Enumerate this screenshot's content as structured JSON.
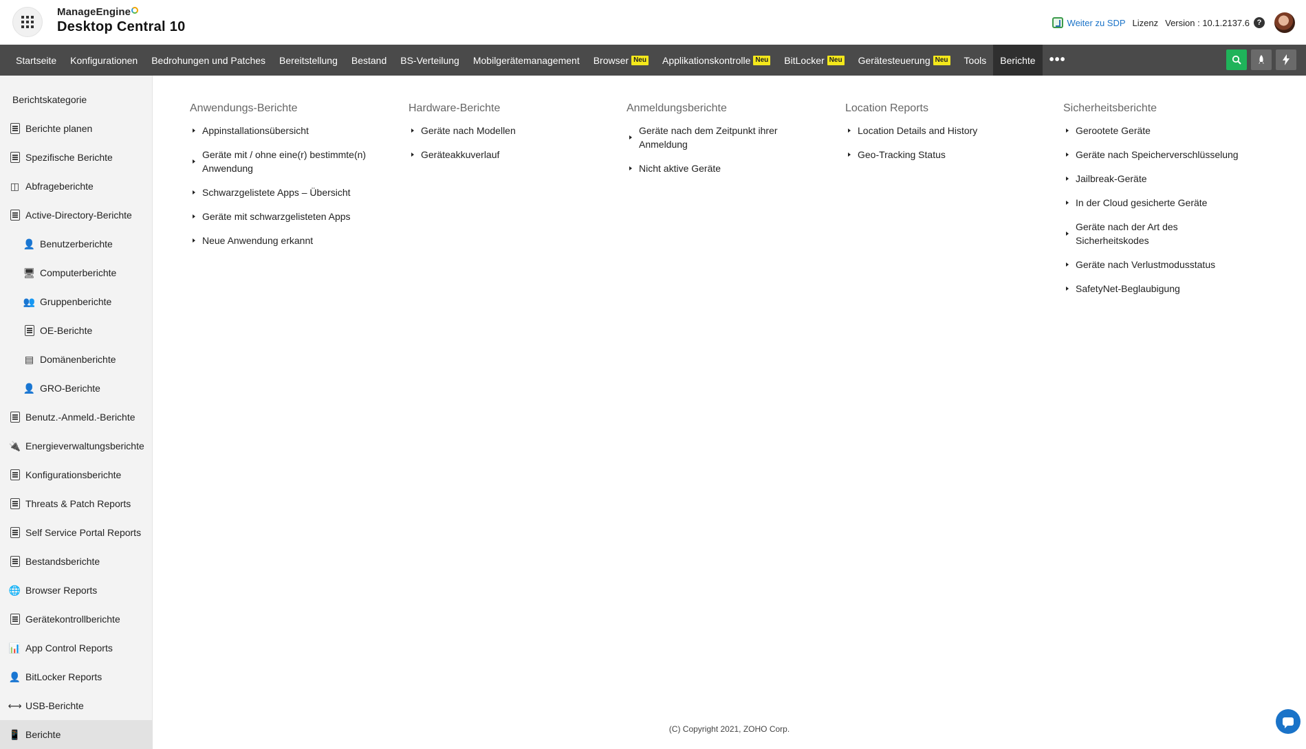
{
  "header": {
    "vendor": "ManageEngine",
    "product": "Desktop Central 10",
    "sdp_link": "Weiter zu SDP",
    "license": "Lizenz",
    "version": "Version : 10.1.2137.6",
    "help": "?"
  },
  "nav": {
    "items": [
      {
        "label": "Startseite",
        "badge": ""
      },
      {
        "label": "Konfigurationen",
        "badge": ""
      },
      {
        "label": "Bedrohungen und Patches",
        "badge": ""
      },
      {
        "label": "Bereitstellung",
        "badge": ""
      },
      {
        "label": "Bestand",
        "badge": ""
      },
      {
        "label": "BS-Verteilung",
        "badge": ""
      },
      {
        "label": "Mobilgerätemanagement",
        "badge": ""
      },
      {
        "label": "Browser",
        "badge": "Neu"
      },
      {
        "label": "Applikationskontrolle",
        "badge": "Neu"
      },
      {
        "label": "BitLocker",
        "badge": "Neu"
      },
      {
        "label": "Gerätesteuerung",
        "badge": "Neu"
      },
      {
        "label": "Tools",
        "badge": ""
      },
      {
        "label": "Berichte",
        "badge": ""
      }
    ],
    "more": "•••",
    "tool_icons": [
      "search-icon",
      "rocket-icon",
      "lightning-icon"
    ]
  },
  "sidebar": {
    "heading": "Berichtskategorie",
    "items": [
      {
        "label": "Berichte planen",
        "icon": "schedule-report-icon"
      },
      {
        "label": "Spezifische Berichte",
        "icon": "custom-report-icon"
      },
      {
        "label": "Abfrageberichte",
        "icon": "database-icon"
      },
      {
        "label": "Active-Directory-Berichte",
        "icon": "active-directory-icon"
      },
      {
        "label": "Benutzerberichte",
        "icon": "user-icon"
      },
      {
        "label": "Computerberichte",
        "icon": "monitor-icon"
      },
      {
        "label": "Gruppenberichte",
        "icon": "group-icon"
      },
      {
        "label": "OE-Berichte",
        "icon": "ou-icon"
      },
      {
        "label": "Domänenberichte",
        "icon": "domain-icon"
      },
      {
        "label": "GRO-Berichte",
        "icon": "gpo-icon"
      },
      {
        "label": "Benutz.-Anmeld.-Berichte",
        "icon": "user-logon-icon"
      },
      {
        "label": "Energieverwaltungsberichte",
        "icon": "power-icon"
      },
      {
        "label": "Konfigurationsberichte",
        "icon": "configuration-icon"
      },
      {
        "label": "Threats & Patch Reports",
        "icon": "patch-report-icon"
      },
      {
        "label": "Self Service Portal Reports",
        "icon": "self-service-icon"
      },
      {
        "label": "Bestandsberichte",
        "icon": "inventory-icon"
      },
      {
        "label": "Browser Reports",
        "icon": "globe-icon"
      },
      {
        "label": "Gerätekontrollberichte",
        "icon": "device-control-icon"
      },
      {
        "label": "App Control Reports",
        "icon": "app-control-icon"
      },
      {
        "label": "BitLocker Reports",
        "icon": "bitlocker-icon"
      },
      {
        "label": "USB-Berichte",
        "icon": "usb-icon"
      },
      {
        "label": "Berichte",
        "icon": "mobile-icon"
      }
    ]
  },
  "columns": [
    {
      "title": "Anwendungs-Berichte",
      "items": [
        "Appinstallationsübersicht",
        "Geräte mit / ohne eine(r) bestimmte(n) Anwendung",
        "Schwarzgelistete Apps – Übersicht",
        "Geräte mit schwarzgelisteten Apps",
        "Neue Anwendung erkannt"
      ]
    },
    {
      "title": "Hardware-Berichte",
      "items": [
        "Geräte nach Modellen",
        "Geräteakkuverlauf"
      ]
    },
    {
      "title": "Anmeldungsberichte",
      "items": [
        "Geräte nach dem Zeitpunkt ihrer Anmeldung",
        "Nicht aktive Geräte"
      ]
    },
    {
      "title": "Location Reports",
      "items": [
        "Location Details and History",
        "Geo-Tracking Status"
      ]
    },
    {
      "title": "Sicherheitsberichte",
      "items": [
        "Gerootete Geräte",
        "Geräte nach Speicherverschlüsselung",
        "Jailbreak-Geräte",
        "In der Cloud gesicherte Geräte",
        "Geräte nach der Art des Sicherheitskodes",
        "Geräte nach Verlustmodusstatus",
        "SafetyNet-Beglaubigung"
      ]
    }
  ],
  "footer": {
    "copyright": "(C) Copyright 2021, ZOHO Corp."
  }
}
